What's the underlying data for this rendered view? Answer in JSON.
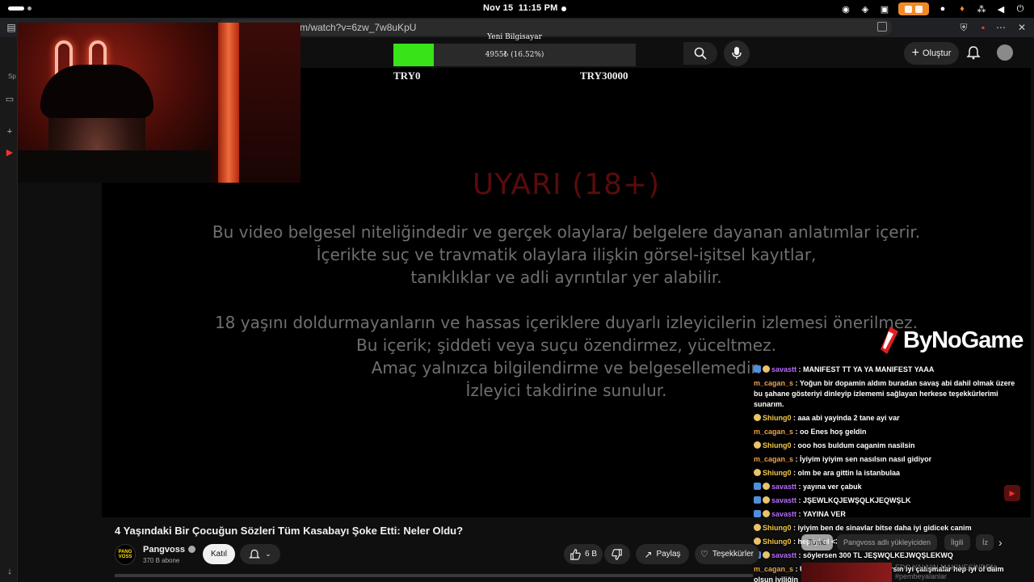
{
  "system": {
    "date": "Nov 15",
    "time": "11:15 PM"
  },
  "browser": {
    "url": "m/watch?v=6zw_7w8uKpU"
  },
  "sidebar": {
    "label": "Sp"
  },
  "header": {
    "create_label": "Oluştur"
  },
  "goal": {
    "title": "Yeni Bilgisayar",
    "progress_text": "4955₺ (16.52%)",
    "progress_fraction": 0.1652,
    "min_label": "TRY0",
    "max_label": "TRY30000",
    "fill_color": "#38e318"
  },
  "video": {
    "warning_title": "UYARI (18+)",
    "paragraph1": [
      "Bu video belgesel niteliğindedir ve gerçek olaylara/ belgelere dayanan anlatımlar içerir.",
      "İçerikte suç ve travmatik olaylara ilişkin görsel-işitsel kayıtlar,",
      "tanıklıklar ve adli ayrıntılar yer alabilir."
    ],
    "paragraph2": [
      "18 yaşını doldurmayanların ve hassas içeriklere duyarlı izleyicilerin izlemesi önerilmez.",
      "Bu içerik; şiddeti veya suçu özendirmez, yüceltmez.",
      "Amaç yalnızca bilgilendirme ve belgesellemedir.",
      "İzleyici takdirine sunulur."
    ]
  },
  "brand_overlay": {
    "text": "ByNoGame"
  },
  "chat": [
    {
      "user": "savastt",
      "msg": "MANIFEST TT YA YA MANIFEST YAAA",
      "color": "purple",
      "badges": [
        "b",
        "y"
      ]
    },
    {
      "user": "m_cagan_s",
      "msg": "Yoğun bir dopamin aldım buradan savaş abi dahil olmak üzere bu şahane gösteriyi dinleyip izlememi sağlayan herkese teşekkürlerimi sunarım.",
      "color": "orange",
      "badges": []
    },
    {
      "user": "Shiung0",
      "msg": "aaa abi yayinda 2 tane ayi var",
      "color": "yellow",
      "badges": [
        "y"
      ]
    },
    {
      "user": "m_cagan_s",
      "msg": "oo Enes hoş geldin",
      "color": "orange",
      "badges": []
    },
    {
      "user": "Shiung0",
      "msg": "ooo hos buldum caganim nasilsin",
      "color": "yellow",
      "badges": [
        "y"
      ]
    },
    {
      "user": "m_cagan_s",
      "msg": "İyiyim iyiyim sen nasılsın nasıl gidiyor",
      "color": "orange",
      "badges": []
    },
    {
      "user": "Shiung0",
      "msg": "olm be ara gittin la istanbulaa",
      "color": "yellow",
      "badges": [
        "y"
      ]
    },
    {
      "user": "savastt",
      "msg": "yayına ver çabuk",
      "color": "purple",
      "badges": [
        "b",
        "y"
      ]
    },
    {
      "user": "savastt",
      "msg": "JŞEWLKQJEWŞQLKJEQWŞLK",
      "color": "purple",
      "badges": [
        "b",
        "y"
      ]
    },
    {
      "user": "savastt",
      "msg": "YAYINA VER",
      "color": "purple",
      "badges": [
        "b",
        "y"
      ]
    },
    {
      "user": "Shiung0",
      "msg": "iyiyim ben de sinavlar bitse daha iyi gidicek canim",
      "color": "yellow",
      "badges": [
        "y"
      ]
    },
    {
      "user": "Shiung0",
      "msg": "hep iyi ol <3",
      "color": "yellow",
      "badges": [
        "y"
      ]
    },
    {
      "user": "savastt",
      "msg": "söylersen 300 TL JEŞWQLKEJWQŞLEKWQ",
      "color": "purple",
      "badges": [
        "b",
        "y"
      ]
    },
    {
      "user": "m_cagan_s",
      "msg": "Umarım istediğin puanı alırsın iyi çalışmalar hep iyi ol daim olsun iyiliğin",
      "color": "orange",
      "badges": []
    }
  ],
  "meta": {
    "title": "4 Yaşındaki Bir Çocuğun Sözleri Tüm Kasabayı Şoke Etti: Neler Oldu?",
    "channel": "Pangvoss",
    "channel_logo": "PANG VOSS",
    "subscribers": "370 B abone",
    "join_label": "Katıl",
    "likes": "6 B",
    "share_label": "Paylaş",
    "thanks_label": "Teşekkürler"
  },
  "filters": {
    "all": "Tümü",
    "uploader": "Pangvoss adlı yükleyiciden",
    "related": "İlgili",
    "more": "İz"
  },
  "recommended": {
    "line1": "EDO YALNIN MAKINESİNDEN",
    "line2": "#pembeyalanlar"
  }
}
